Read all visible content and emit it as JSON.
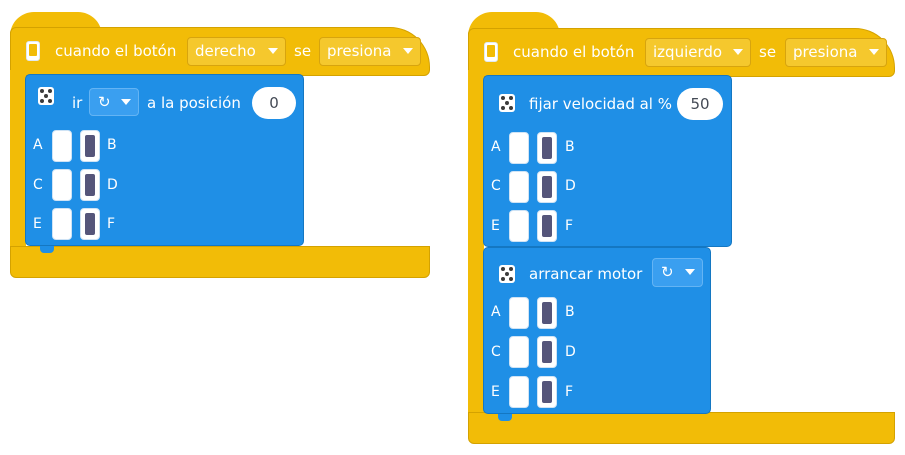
{
  "stack_left": {
    "event": {
      "prefix": "cuando el botón",
      "button_value": "derecho",
      "mid": "se",
      "action_value": "presiona"
    },
    "block": {
      "label_ir": "ir",
      "label_position": "a la posición",
      "position_value": "0",
      "direction_icon": "↻",
      "ports": [
        {
          "left": "A",
          "right": "B"
        },
        {
          "left": "C",
          "right": "D"
        },
        {
          "left": "E",
          "right": "F"
        }
      ]
    }
  },
  "stack_right": {
    "event": {
      "prefix": "cuando el botón",
      "button_value": "izquierdo",
      "mid": "se",
      "action_value": "presiona"
    },
    "speed_block": {
      "label": "fijar velocidad al %",
      "value": "50",
      "ports": [
        {
          "left": "A",
          "right": "B"
        },
        {
          "left": "C",
          "right": "D"
        },
        {
          "left": "E",
          "right": "F"
        }
      ]
    },
    "start_block": {
      "label": "arrancar motor",
      "direction_icon": "↻",
      "ports": [
        {
          "left": "A",
          "right": "B"
        },
        {
          "left": "C",
          "right": "D"
        },
        {
          "left": "E",
          "right": "F"
        }
      ]
    }
  },
  "colors": {
    "event_yellow": "#f2bc07",
    "motor_blue": "#1f8fe6"
  },
  "icons": {
    "hub": "hub-icon",
    "motor": "motor-icon",
    "rotation": "clockwise-rotation-icon",
    "caret": "caret-down-icon"
  }
}
